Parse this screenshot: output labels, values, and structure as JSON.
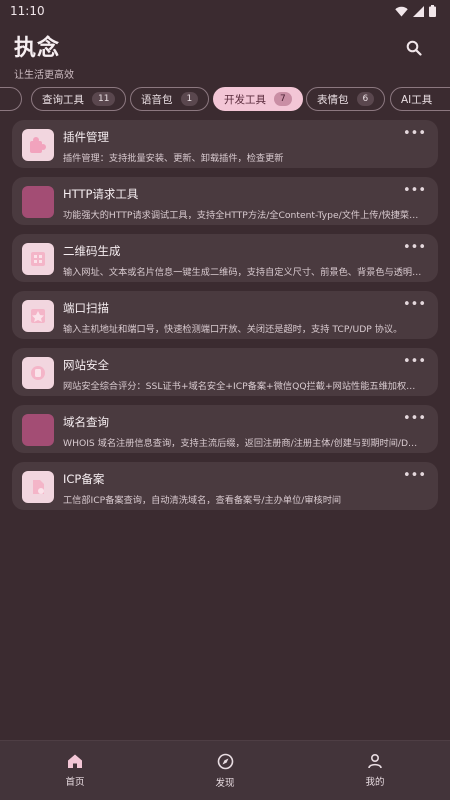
{
  "status_bar": {
    "time": "11:10"
  },
  "header": {
    "title": "执念",
    "subtitle": "让生活更高效"
  },
  "tabs": [
    {
      "label": "查询工具",
      "count": "11",
      "active": false
    },
    {
      "label": "语音包",
      "count": "1",
      "active": false
    },
    {
      "label": "开发工具",
      "count": "7",
      "active": true
    },
    {
      "label": "表情包",
      "count": "6",
      "active": false
    },
    {
      "label": "AI工具",
      "count": "",
      "active": false
    }
  ],
  "tools": [
    {
      "title": "插件管理",
      "desc": "插件管理：支持批量安装、更新、卸载插件，检查更新",
      "icon": "puzzle-icon"
    },
    {
      "title": "HTTP请求工具",
      "desc": "功能强大的HTTP请求调试工具，支持全HTTP方法/全Content-Type/文件上传/快捷菜…",
      "icon": "http-icon"
    },
    {
      "title": "二维码生成",
      "desc": "输入网址、文本或名片信息一键生成二维码，支持自定义尺寸、前景色、背景色与透明…",
      "icon": "qrcode-icon"
    },
    {
      "title": "端口扫描",
      "desc": "输入主机地址和端口号，快速检测端口开放、关闭还是超时，支持 TCP/UDP 协议。",
      "icon": "port-scan-icon"
    },
    {
      "title": "网站安全",
      "desc": "网站安全综合评分：SSL证书+域名安全+ICP备案+微信QQ拦截+网站性能五维加权评分…",
      "icon": "shield-icon"
    },
    {
      "title": "域名查询",
      "desc": "WHOIS 域名注册信息查询，支持主流后缀，返回注册商/注册主体/创建与到期时间/DN…",
      "icon": "domain-icon"
    },
    {
      "title": "ICP备案",
      "desc": "工信部ICP备案查询，自动清洗域名，查看备案号/主办单位/审核时间",
      "icon": "document-icon"
    }
  ],
  "more_symbol": "•••",
  "bottom_nav": [
    {
      "label": "首页",
      "icon": "home-icon"
    },
    {
      "label": "发现",
      "icon": "compass-icon"
    },
    {
      "label": "我的",
      "icon": "user-icon"
    }
  ],
  "colors": {
    "background": "#3b2b30",
    "card": "#4a3a3f",
    "accent": "#f3c6d6",
    "icon_bg": "#f2d6df",
    "icon_plain": "#a34d74"
  }
}
